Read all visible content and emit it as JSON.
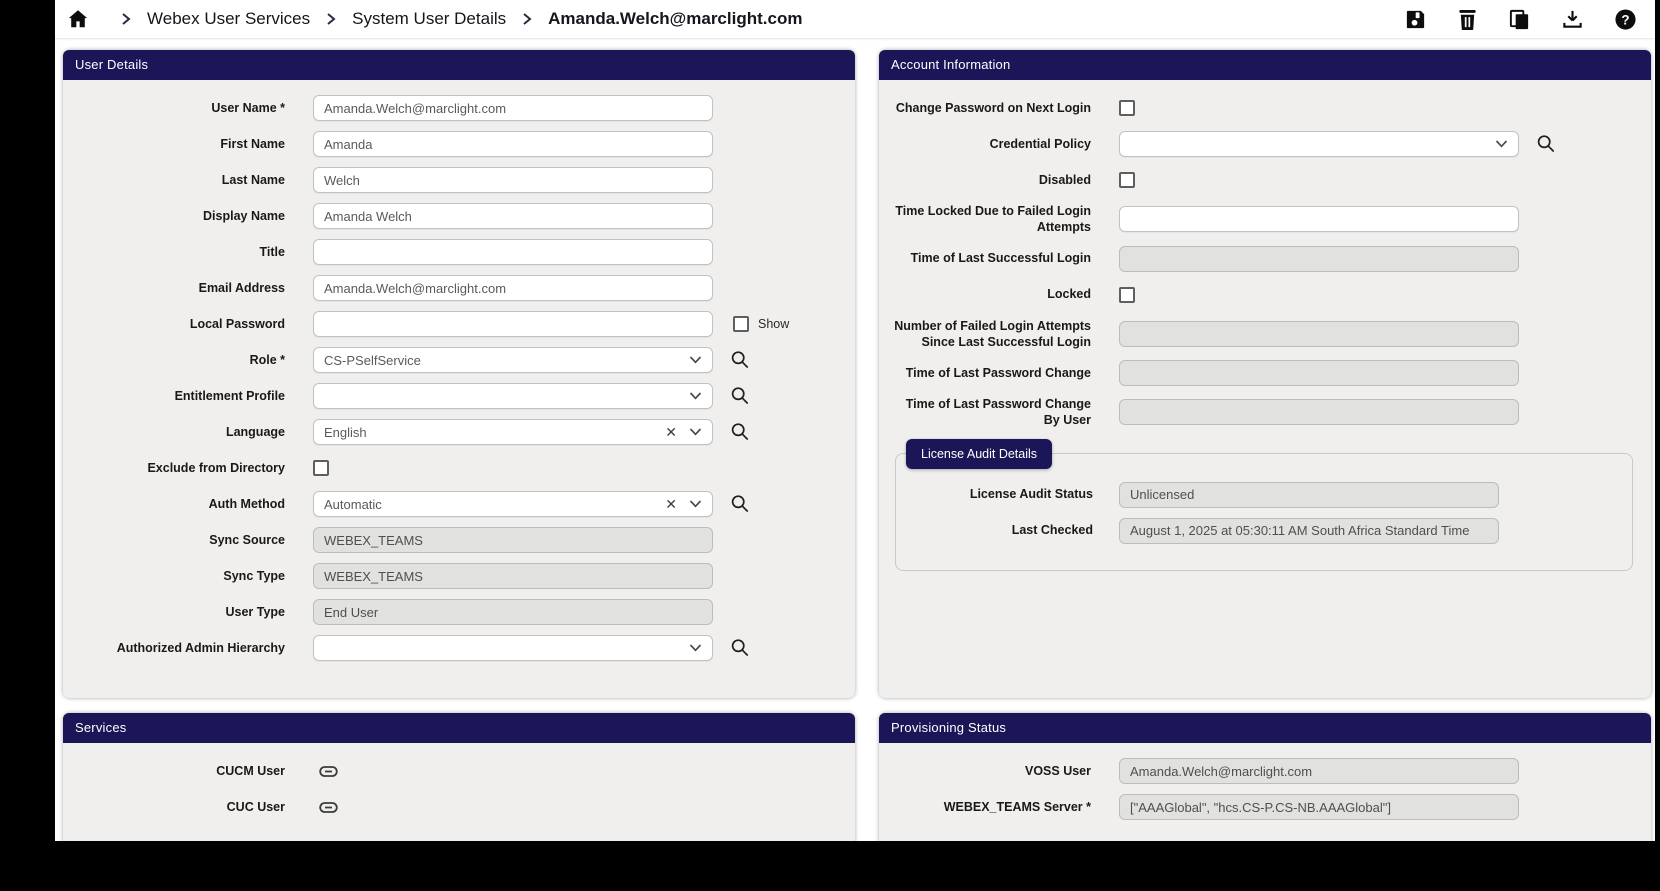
{
  "breadcrumb": {
    "items": [
      "Webex User Services",
      "System User Details",
      "Amanda.Welch@marclight.com"
    ]
  },
  "toolbar": {
    "save": "Save",
    "delete": "Delete",
    "clone": "Clone",
    "export": "Export",
    "help": "Help"
  },
  "colors": {
    "header_navy": "#1a1657",
    "panel_bg": "#f0efee",
    "disabled_bg": "#e1e1e0"
  },
  "panels": {
    "user_details": {
      "title": "User Details",
      "fields": [
        {
          "label": "User Name *",
          "type": "text",
          "value": "Amanda.Welch@marclight.com"
        },
        {
          "label": "First Name",
          "type": "text",
          "value": "Amanda"
        },
        {
          "label": "Last Name",
          "type": "text",
          "value": "Welch"
        },
        {
          "label": "Display Name",
          "type": "text",
          "value": "Amanda Welch"
        },
        {
          "label": "Title",
          "type": "text",
          "value": ""
        },
        {
          "label": "Email Address",
          "type": "text",
          "value": "Amanda.Welch@marclight.com"
        },
        {
          "label": "Local Password",
          "type": "password",
          "value": "",
          "extra": "Show"
        },
        {
          "label": "Role *",
          "type": "select",
          "value": "CS-PSelfService",
          "clearable": false,
          "lookup": true
        },
        {
          "label": "Entitlement Profile",
          "type": "select",
          "value": "",
          "clearable": false,
          "lookup": true
        },
        {
          "label": "Language",
          "type": "select",
          "value": "English",
          "clearable": true,
          "lookup": true
        },
        {
          "label": "Exclude from Directory",
          "type": "checkbox",
          "checked": false
        },
        {
          "label": "Auth Method",
          "type": "select",
          "value": "Automatic",
          "clearable": true,
          "lookup": true
        },
        {
          "label": "Sync Source",
          "type": "disabled",
          "value": "WEBEX_TEAMS"
        },
        {
          "label": "Sync Type",
          "type": "disabled",
          "value": "WEBEX_TEAMS"
        },
        {
          "label": "User Type",
          "type": "disabled",
          "value": "End User"
        },
        {
          "label": "Authorized Admin Hierarchy",
          "type": "select",
          "value": "",
          "clearable": false,
          "lookup": true
        }
      ]
    },
    "account_information": {
      "title": "Account Information",
      "fields": [
        {
          "label": "Change Password on Next Login",
          "type": "checkbox",
          "checked": false
        },
        {
          "label": "Credential Policy",
          "type": "select",
          "value": "",
          "clearable": false,
          "lookup": true
        },
        {
          "label": "Disabled",
          "type": "checkbox",
          "checked": false
        },
        {
          "label": "Time Locked Due to Failed Login Attempts",
          "type": "text",
          "value": ""
        },
        {
          "label": "Time of Last Successful Login",
          "type": "disabled",
          "value": ""
        },
        {
          "label": "Locked",
          "type": "checkbox",
          "checked": false
        },
        {
          "label": "Number of Failed Login Attempts Since Last Successful Login",
          "type": "disabled",
          "value": ""
        },
        {
          "label": "Time of Last Password Change",
          "type": "disabled",
          "value": ""
        },
        {
          "label": "Time of Last Password Change By User",
          "type": "disabled",
          "value": ""
        }
      ],
      "license_audit": {
        "title": "License Audit Details",
        "fields": [
          {
            "label": "License Audit Status",
            "type": "disabled",
            "value": "Unlicensed"
          },
          {
            "label": "Last Checked",
            "type": "disabled",
            "value": "August 1, 2025 at 05:30:11 AM South Africa Standard Time"
          }
        ]
      }
    },
    "services": {
      "title": "Services",
      "fields": [
        {
          "label": "CUCM User",
          "type": "link"
        },
        {
          "label": "CUC User",
          "type": "link"
        }
      ]
    },
    "provisioning_status": {
      "title": "Provisioning Status",
      "fields": [
        {
          "label": "VOSS User",
          "type": "disabled",
          "value": "Amanda.Welch@marclight.com"
        },
        {
          "label": "WEBEX_TEAMS Server *",
          "type": "disabled",
          "value": "[\"AAAGlobal\", \"hcs.CS-P.CS-NB.AAAGlobal\"]"
        }
      ]
    }
  }
}
